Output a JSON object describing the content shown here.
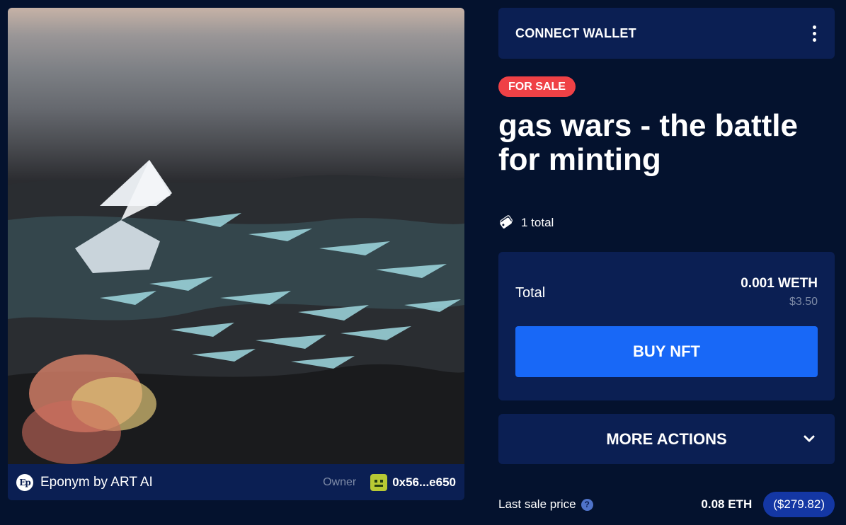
{
  "artwork": {
    "alt": "",
    "collection_name": "Eponym by ART AI",
    "collection_logo_text": "Ep",
    "owner_label": "Owner",
    "owner_address": "0x56...e650"
  },
  "header": {
    "connect_wallet_label": "CONNECT WALLET",
    "menu_icon": "kebab-menu-icon"
  },
  "listing": {
    "status_badge": "FOR SALE",
    "title": "gas wars - the battle for minting",
    "supply_text": "1 total",
    "supply_icon": "tags-icon"
  },
  "price": {
    "total_label": "Total",
    "amount": "0.001 WETH",
    "usd": "$3.50",
    "buy_label": "BUY NFT"
  },
  "more_actions": {
    "label": "MORE ACTIONS",
    "icon": "chevron-down-icon"
  },
  "last_sale": {
    "label": "Last sale price",
    "eth": "0.08 ETH",
    "usd": "($279.82)"
  },
  "colors": {
    "background": "#04122e",
    "panel": "#0b1f53",
    "sale_badge": "#ef4146",
    "buy_button": "#1868f7",
    "usd_pill": "#1437a4",
    "muted_text": "#7d8aa6"
  }
}
